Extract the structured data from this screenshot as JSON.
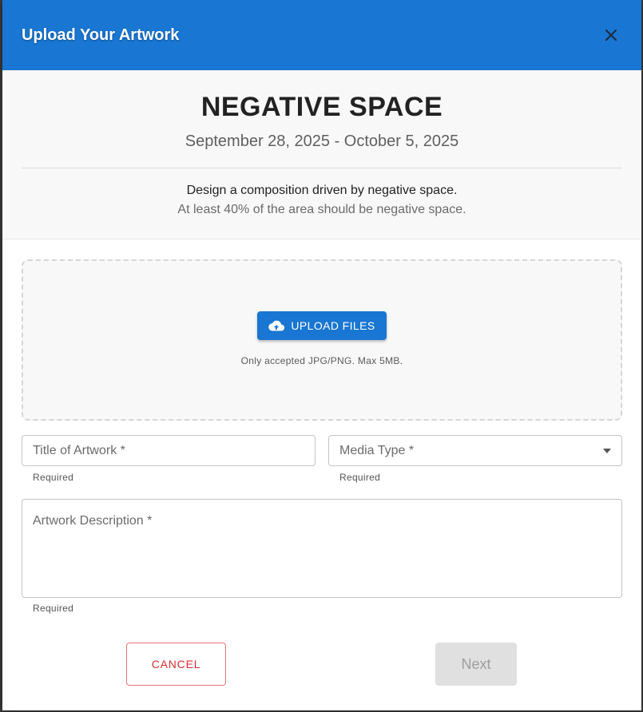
{
  "dialog": {
    "title": "Upload Your Artwork"
  },
  "prompt": {
    "title": "NEGATIVE SPACE",
    "dates": "September 28, 2025 - October 5, 2025",
    "description": "Design a composition driven by negative space.",
    "rule": "At least 40% of the area should be negative space."
  },
  "upload": {
    "button_label": "UPLOAD FILES",
    "hint": "Only accepted JPG/PNG. Max 5MB."
  },
  "form": {
    "title_field": {
      "label": "Title of Artwork *",
      "value": "",
      "helper": "Required"
    },
    "media_type_field": {
      "label": "Media Type *",
      "value": "",
      "helper": "Required"
    },
    "description_field": {
      "label": "Artwork Description *",
      "value": "",
      "helper": "Required"
    }
  },
  "actions": {
    "cancel_label": "CANCEL",
    "next_label": "Next"
  },
  "colors": {
    "header_bg": "#1976d2",
    "primary": "#1976d2",
    "cancel": "#d32f2f",
    "disabled_bg": "#e0e0e0"
  },
  "icons": {
    "close": "close-icon",
    "upload": "cloud-upload-icon",
    "dropdown": "caret-down-icon"
  }
}
